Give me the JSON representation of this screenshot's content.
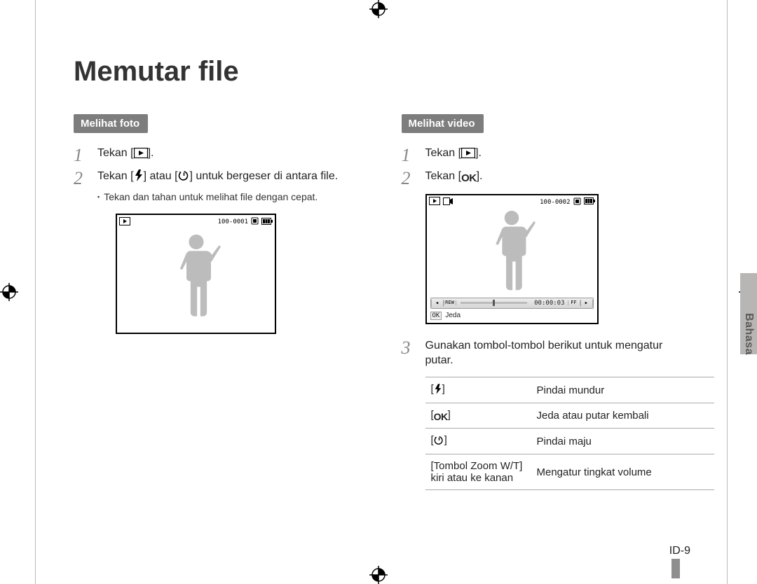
{
  "title": "Memutar file",
  "sections": {
    "photo": {
      "label": "Melihat foto",
      "steps": [
        {
          "pre": "Tekan [",
          "post": "]."
        },
        {
          "pre": "Tekan [",
          "mid": "] atau [",
          "post": "] untuk bergeser di antara file."
        }
      ],
      "note": "Tekan dan tahan untuk melihat file dengan cepat.",
      "screen_counter": "100-0001"
    },
    "video": {
      "label": "Melihat video",
      "steps": [
        {
          "pre": "Tekan [",
          "post": "]."
        },
        {
          "pre": "Tekan [",
          "post": "]."
        }
      ],
      "step3": "Gunakan tombol-tombol berikut untuk mengatur putar.",
      "screen_counter": "100-0002",
      "time": "00:00:03",
      "pause_label": "Jeda",
      "table": [
        {
          "key_type": "flash",
          "desc": "Pindai mundur"
        },
        {
          "key_type": "ok",
          "desc": "Jeda atau putar kembali"
        },
        {
          "key_type": "timer",
          "desc": "Pindai maju"
        },
        {
          "key_text": "[Tombol Zoom W/T] kiri atau ke kanan",
          "desc": "Mengatur tingkat volume"
        }
      ]
    }
  },
  "side_tab": "Bahasa",
  "page_number": "ID-9",
  "icons": {
    "play_button": "play-button-icon",
    "flash": "flash-icon",
    "timer": "self-timer-icon",
    "ok": "OK"
  }
}
